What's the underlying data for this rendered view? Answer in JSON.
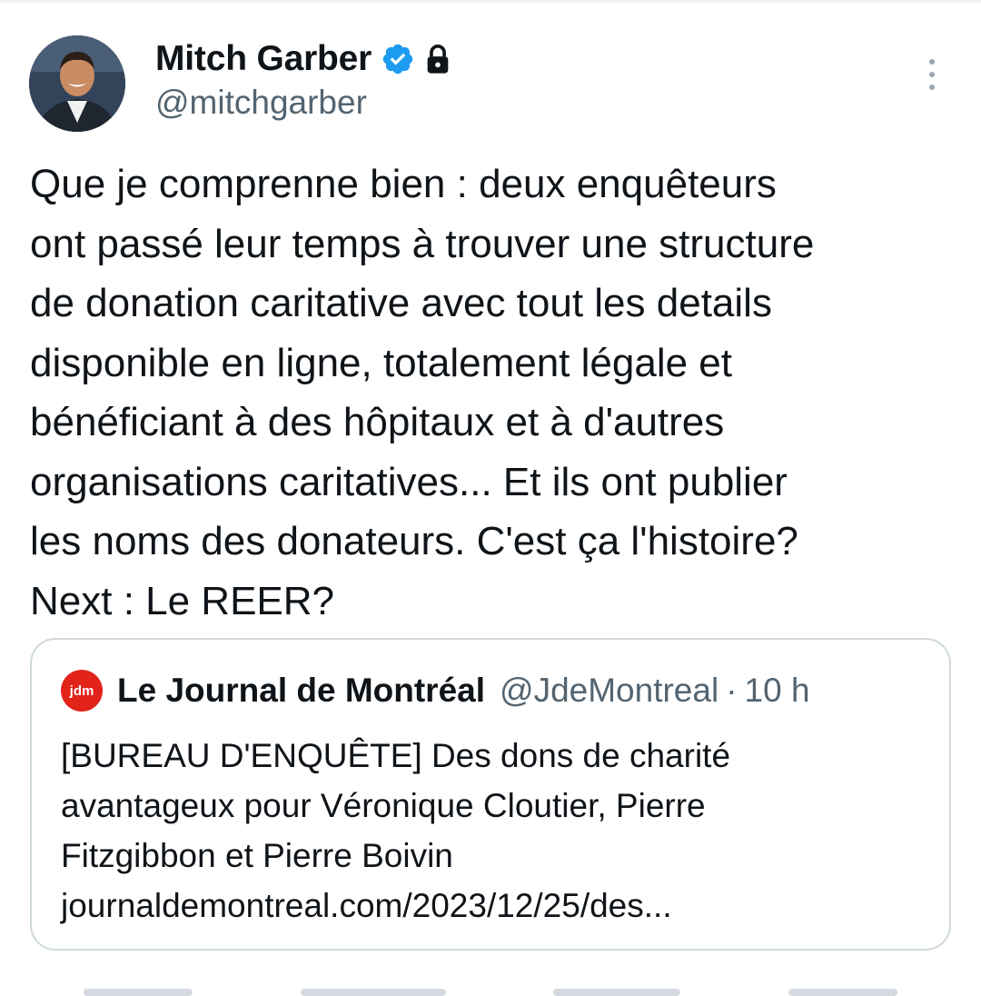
{
  "tweet": {
    "author_name": "Mitch Garber",
    "author_handle": "@mitchgarber",
    "text_lines": [
      "Que je comprenne bien : deux enquêteurs",
      "ont passé leur temps à trouver une structure",
      "de donation caritative avec tout les details",
      "disponible en ligne, totalement légale et",
      "bénéficiant à des hôpitaux et à d'autres",
      "organisations caritatives... Et ils ont publier",
      "les noms des donateurs. C'est ça l'histoire?",
      "Next : Le REER?"
    ]
  },
  "quote": {
    "logo_text": "jdm",
    "name": "Le Journal de Montréal",
    "handle": "@JdeMontreal",
    "separator": "·",
    "time": "10 h",
    "text_lines": [
      "[BUREAU D'ENQUÊTE] Des dons de charité",
      "avantageux pour Véronique Cloutier, Pierre",
      "Fitzgibbon et Pierre Boivin",
      "journaldemontreal.com/2023/12/25/des..."
    ]
  },
  "icons": {
    "verified": "verified-badge-icon",
    "lock": "lock-icon",
    "more": "more-options-icon"
  },
  "colors": {
    "verified_blue": "#1d9bf0",
    "jdm_red": "#e2231a",
    "secondary_text": "#536471",
    "border": "#cfd9de"
  }
}
